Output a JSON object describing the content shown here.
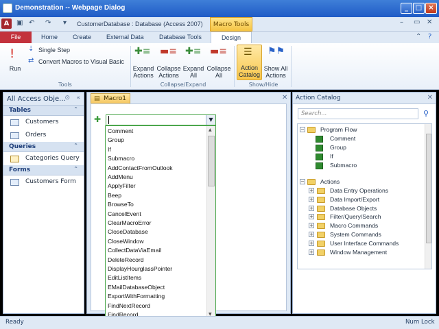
{
  "window": {
    "title": "Demonstration -- Webpage Dialog"
  },
  "app": {
    "title": "CustomerDatabase : Database (Access 2007)",
    "logo": "A",
    "contextual_tab": "Macro Tools"
  },
  "tabs": [
    "File",
    "Home",
    "Create",
    "External Data",
    "Database Tools",
    "Design"
  ],
  "ribbon": {
    "run": "Run",
    "single_step": "Single Step",
    "convert": "Convert Macros to Visual Basic",
    "tools_group": "Tools",
    "expand_actions": [
      "Expand",
      "Actions"
    ],
    "collapse_actions": [
      "Collapse",
      "Actions"
    ],
    "expand_all": [
      "Expand",
      "All"
    ],
    "collapse_all": [
      "Collapse",
      "All"
    ],
    "collapse_group": "Collapse/Expand",
    "action_catalog": [
      "Action",
      "Catalog"
    ],
    "show_all_actions": [
      "Show All",
      "Actions"
    ],
    "showhide_group": "Show/Hide"
  },
  "nav": {
    "header": "All Access Obje...",
    "sections": [
      {
        "label": "Tables",
        "items": [
          "Customers",
          "Orders"
        ]
      },
      {
        "label": "Queries",
        "items": [
          "Categories Query"
        ]
      },
      {
        "label": "Forms",
        "items": [
          "Customers Form"
        ]
      }
    ]
  },
  "doc": {
    "tab": "Macro1"
  },
  "dropdown": [
    "Comment",
    "Group",
    "If",
    "Submacro",
    "AddContactFromOutlook",
    "AddMenu",
    "ApplyFilter",
    "Beep",
    "BrowseTo",
    "CancelEvent",
    "ClearMacroError",
    "CloseDatabase",
    "CloseWindow",
    "CollectDataViaEmail",
    "DeleteRecord",
    "DisplayHourglassPointer",
    "EditListItems",
    "EMailDatabaseObject",
    "ExportWithFormatting",
    "FindNextRecord",
    "FindRecord"
  ],
  "catalog": {
    "title": "Action Catalog",
    "search_placeholder": "Search...",
    "program_flow": "Program Flow",
    "pf_items": [
      "Comment",
      "Group",
      "If",
      "Submacro"
    ],
    "actions": "Actions",
    "action_folders": [
      "Data Entry Operations",
      "Data Import/Export",
      "Database Objects",
      "Filter/Query/Search",
      "Macro Commands",
      "System Commands",
      "User Interface Commands",
      "Window Management"
    ]
  },
  "status": {
    "left": "Ready",
    "right": "Num Lock"
  },
  "colors": {
    "accent": "#1f5bc6",
    "file_tab": "#c3323c",
    "highlight": "#f5c443",
    "action_green": "#4ca74c"
  }
}
